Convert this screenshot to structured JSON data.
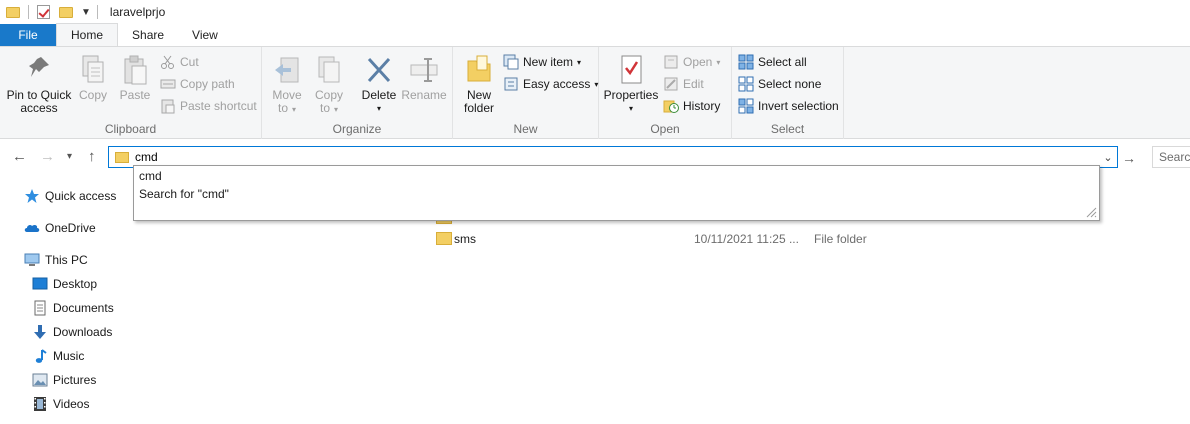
{
  "window": {
    "title": "laravelprjo"
  },
  "tabs": [
    "File",
    "Home",
    "Share",
    "View"
  ],
  "ribbon": {
    "clipboard": {
      "label": "Clipboard",
      "pin_line1": "Pin to Quick",
      "pin_line2": "access",
      "copy": "Copy",
      "paste": "Paste",
      "cut": "Cut",
      "copy_path": "Copy path",
      "paste_shortcut": "Paste shortcut"
    },
    "organize": {
      "label": "Organize",
      "move_line1": "Move",
      "move_line2": "to",
      "copy_line1": "Copy",
      "copy_line2": "to",
      "delete": "Delete",
      "rename": "Rename"
    },
    "new": {
      "label": "New",
      "new_folder_line1": "New",
      "new_folder_line2": "folder",
      "new_item": "New item",
      "easy_access": "Easy access"
    },
    "open": {
      "label": "Open",
      "properties": "Properties",
      "open": "Open",
      "edit": "Edit",
      "history": "History"
    },
    "select": {
      "label": "Select",
      "select_all": "Select all",
      "select_none": "Select none",
      "invert_selection": "Invert selection"
    }
  },
  "address": {
    "value": "cmd"
  },
  "search": {
    "placeholder": "Searc"
  },
  "autocomplete": [
    "cmd",
    "Search for \"cmd\""
  ],
  "nav": {
    "quick_access": "Quick access",
    "onedrive": "OneDrive",
    "this_pc": "This PC",
    "desktop": "Desktop",
    "documents": "Documents",
    "downloads": "Downloads",
    "music": "Music",
    "pictures": "Pictures",
    "videos": "Videos"
  },
  "files": [
    {
      "name": "sms",
      "date": "10/11/2021 11:25 ...",
      "type": "File folder"
    }
  ],
  "colors": {
    "accent": "#0078d7",
    "file_tab": "#1979ca",
    "folder": "#f3cf63"
  }
}
